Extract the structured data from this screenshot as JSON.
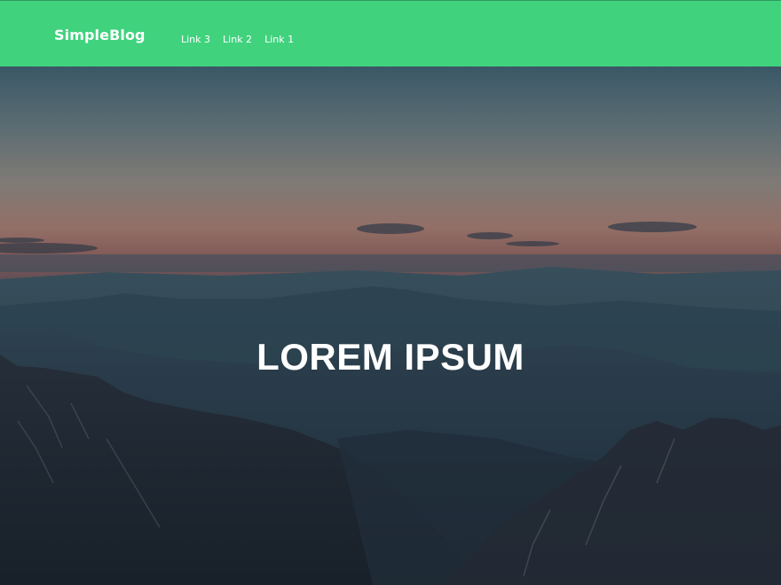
{
  "navbar": {
    "brand": "SimpleBlog",
    "links": [
      {
        "label": "Link 3"
      },
      {
        "label": "Link 2"
      },
      {
        "label": "Link 1"
      }
    ]
  },
  "hero": {
    "title": "LOREM IPSUM"
  },
  "colors": {
    "navbar_background": "#41d27e",
    "text": "#ffffff"
  }
}
